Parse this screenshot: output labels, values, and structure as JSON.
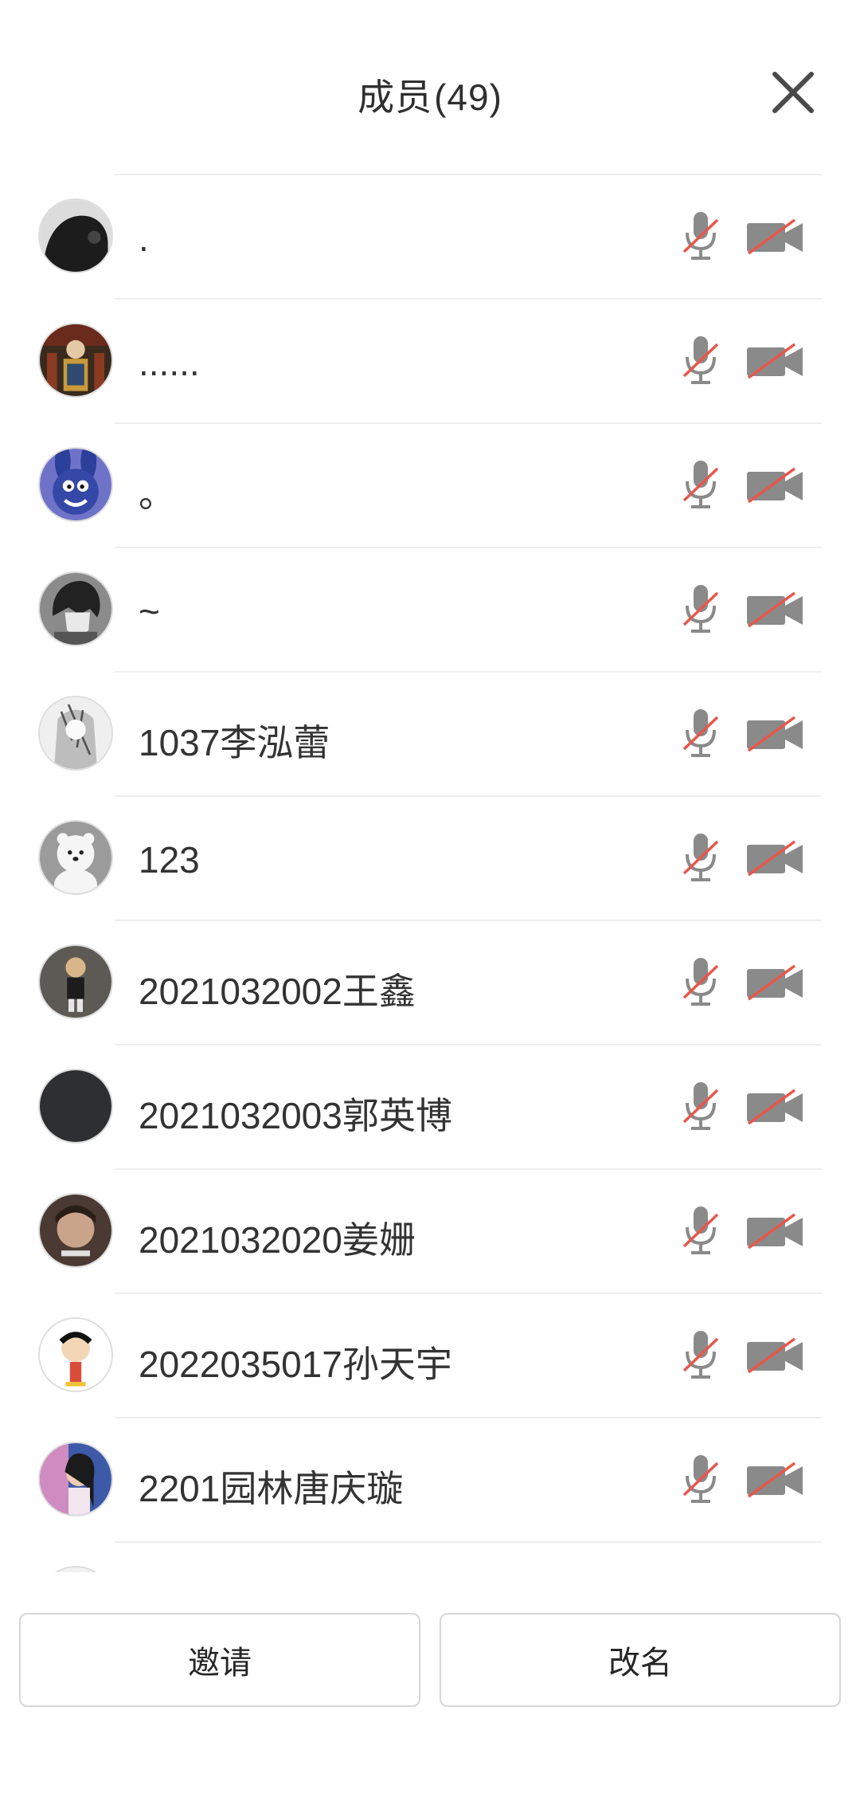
{
  "header": {
    "title": "成员",
    "count": "(49)"
  },
  "members": [
    {
      "name": ".",
      "avatar": "dark-hooded-figure"
    },
    {
      "name": "......",
      "avatar": "ornate-warrior"
    },
    {
      "name": "。",
      "avatar": "blue-bunny"
    },
    {
      "name": "~",
      "avatar": "anime-boy-grey"
    },
    {
      "name": "1037李泓蕾",
      "avatar": "manga-sketch"
    },
    {
      "name": "123",
      "avatar": "white-bear"
    },
    {
      "name": "2021032002王鑫",
      "avatar": "cartoon-kid"
    },
    {
      "name": "2021032003郭英博",
      "avatar": "solid-dark"
    },
    {
      "name": "2021032020姜姗",
      "avatar": "selfie-photo"
    },
    {
      "name": "2022035017孙天宇",
      "avatar": "crayon-boy"
    },
    {
      "name": "2201园林唐庆璇",
      "avatar": "girl-photo"
    }
  ],
  "status_icons": {
    "mic": "mic-muted-icon",
    "camera": "camera-off-icon",
    "strike_color": "#e8574b",
    "icon_color": "#888888"
  },
  "footer": {
    "invite_label": "邀请",
    "rename_label": "改名"
  }
}
